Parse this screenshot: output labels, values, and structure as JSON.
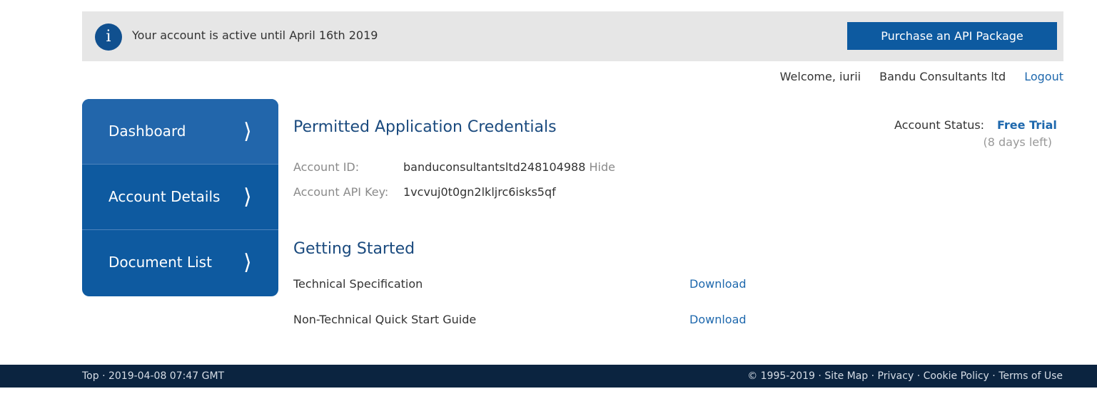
{
  "banner": {
    "info_icon": "i",
    "message": "Your account is active until April 16th 2019",
    "purchase_label": "Purchase an API Package"
  },
  "user_bar": {
    "welcome": "Welcome, iurii",
    "company": "Bandu Consultants ltd",
    "logout": "Logout"
  },
  "sidebar": {
    "items": [
      {
        "label": "Dashboard",
        "arrow": "⟩"
      },
      {
        "label": "Account Details",
        "arrow": "⟩"
      },
      {
        "label": "Document List",
        "arrow": "⟩"
      }
    ]
  },
  "credentials": {
    "title": "Permitted Application Credentials",
    "account_id_label": "Account ID:",
    "account_id_value": "banduconsultantsltd248104988",
    "hide_label": "Hide",
    "api_key_label": "Account API Key:",
    "api_key_value": "1vcvuj0t0gn2lkljrc6isks5qf"
  },
  "account_status": {
    "label": "Account Status:",
    "value": "Free Trial",
    "days_left": "(8 days left)"
  },
  "getting_started": {
    "title": "Getting Started",
    "docs": [
      {
        "name": "Technical Specification",
        "link": "Download"
      },
      {
        "name": "Non-Technical Quick Start Guide",
        "link": "Download"
      }
    ]
  },
  "footer": {
    "top_link": "Top",
    "sep": " · ",
    "datetime": "2019-04-08 07:47 GMT",
    "copyright": "© 1995-2019",
    "links": [
      "Site Map",
      "Privacy",
      "Cookie Policy",
      "Terms of Use"
    ]
  },
  "colors": {
    "primary": "#0d5aa0",
    "active_nav": "#2266ab",
    "link": "#1e68ad",
    "footer_bg": "#0b2440",
    "banner_bg": "#e6e6e6"
  }
}
